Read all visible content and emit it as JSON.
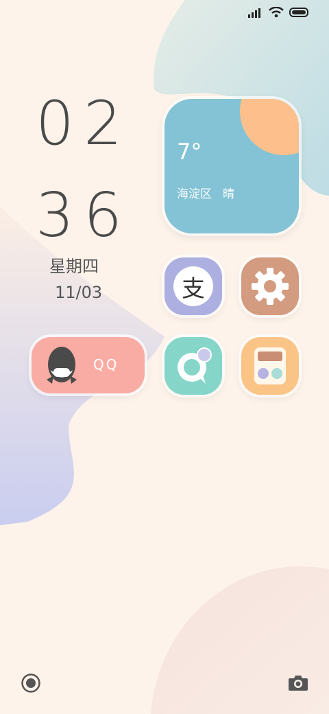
{
  "status_bar": {
    "signal_icon": "signal-bars-icon",
    "wifi_icon": "wifi-icon",
    "battery_icon": "battery-icon"
  },
  "clock": {
    "hours": "02",
    "minutes": "36",
    "weekday": "星期四",
    "date": "11/03"
  },
  "weather": {
    "temperature": "7°",
    "location": "海淀区",
    "condition": "晴"
  },
  "apps": {
    "alipay": {
      "glyph": "支",
      "icon": "alipay-icon",
      "color": "#adafe0"
    },
    "settings": {
      "icon": "gear-icon",
      "color": "#d39b7f"
    },
    "chat": {
      "icon": "chat-bubble-icon",
      "color": "#86d5c9"
    },
    "calculator": {
      "icon": "calculator-icon",
      "color": "#fbc487"
    }
  },
  "qq": {
    "label": "QQ",
    "icon": "penguin-icon",
    "color": "#f9aca3"
  },
  "dock": {
    "left_icon": "record-icon",
    "right_icon": "camera-icon"
  },
  "colors": {
    "background": "#fdf3ea",
    "weather_card": "#83c3d5",
    "sun": "#fdc08c"
  }
}
